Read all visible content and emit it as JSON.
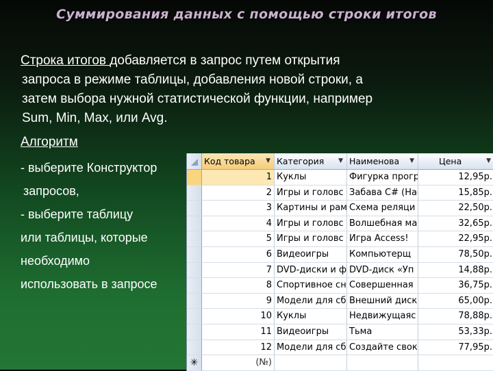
{
  "title": "Суммирования данных с помощью строки итогов",
  "paragraph": {
    "underlined": "Строка итогов ",
    "line1_rest": "добавляется в запрос путем открытия",
    "line2": "запроса в режиме таблицы, добавления новой строки, а",
    "line3": "затем выбора нужной статистической функции, например",
    "line4": "Sum, Min, Max, или Avg."
  },
  "algorithm_label": "Алгоритм",
  "steps": [
    "- выберите Конструктор",
    "запросов,",
    "- выберите таблицу",
    "или таблицы, которые",
    "необходимо",
    "использовать в запросе"
  ],
  "grid": {
    "columns": [
      "Код товара",
      "Категория",
      "Наименова",
      "Цена"
    ],
    "rows": [
      [
        "1",
        "Куклы",
        "Фигурка прогр",
        "12,95р."
      ],
      [
        "2",
        "Игры и головс",
        "Забава C# (Нас",
        "15,85р."
      ],
      [
        "3",
        "Картины и рам",
        "Схема реляци",
        "22,50р."
      ],
      [
        "4",
        "Игры и головс",
        "Волшебная ма",
        "32,65р."
      ],
      [
        "5",
        "Игры и головс",
        "Игра Access!",
        "22,95р."
      ],
      [
        "6",
        "Видеоигры",
        "Компьютерщ",
        "78,50р."
      ],
      [
        "7",
        "DVD-диски и ф",
        "DVD-диск «Уп",
        "14,88р."
      ],
      [
        "8",
        "Спортивное сн",
        "Совершенная",
        "36,75р."
      ],
      [
        "9",
        "Модели для сб",
        "Внешний диск",
        "65,00р."
      ],
      [
        "10",
        "Куклы",
        "Недвижущаяс",
        "78,88р."
      ],
      [
        "11",
        "Видеоигры",
        "Тьма",
        "53,33р."
      ],
      [
        "12",
        "Модели для сб",
        "Создайте свок",
        "77,95р."
      ]
    ],
    "new_row_marker": "✳",
    "new_row_value": "(№)"
  }
}
